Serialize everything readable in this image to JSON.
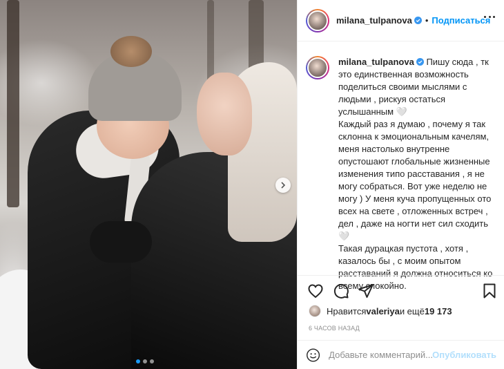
{
  "header": {
    "username": "milana_tulpanova",
    "separator": "•",
    "follow_label": "Подписаться"
  },
  "caption": {
    "username": "milana_tulpanova",
    "text": "Пишу сюда , тк это единственная возможность поделиться своими мыслями с людьми , рискуя остаться услышанным 🤍\nКаждый раз я думаю , почему я так склонна к эмоциональным качелям, меня настолько внутренне опустошают глобальные жизненные изменения типо расставания , я не могу собраться. Вот уже неделю не могу ) У меня куча пропущенных ото всех на свете , отложенных встреч , дел , даже на ногти нет сил сходить 🤍\nТакая дурацкая пустота , хотя , казалось бы , с моим опытом расставаний я должна относиться ко всему спокойно."
  },
  "likes": {
    "prefix": "Нравится ",
    "liker": "valeriya",
    "middle": " и ещё ",
    "count": "19 173"
  },
  "timestamp": "6 часов назад",
  "comment": {
    "placeholder": "Добавьте комментарий...",
    "publish_label": "Опубликовать"
  },
  "carousel": {
    "slides": 3,
    "active_index": 0
  },
  "colors": {
    "accent": "#0095f6",
    "publish_disabled": "#b2dffc",
    "active_dot": "#1a9af5",
    "verified": "#3897f0"
  },
  "icons": {
    "actions": [
      "heart-icon",
      "comment-icon",
      "share-icon",
      "bookmark-icon"
    ],
    "carousel_next": "chevron-right-icon",
    "comment_emoji": "emoji-icon",
    "more": "more-options-icon"
  }
}
